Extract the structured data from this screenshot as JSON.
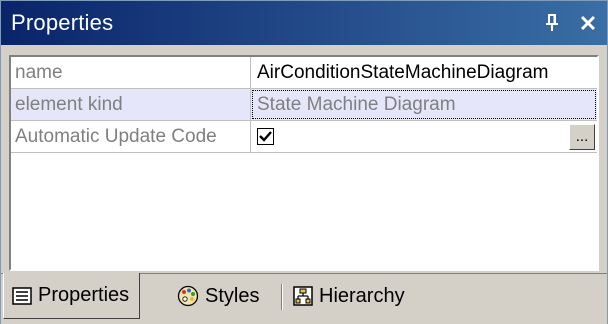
{
  "panel": {
    "title": "Properties",
    "controls": {
      "pin_icon": "pin-icon",
      "close_icon": "close-icon"
    }
  },
  "properties": [
    {
      "name": "name",
      "value": "AirConditionStateMachineDiagram",
      "selected": false
    },
    {
      "name": "element kind",
      "value": "State Machine Diagram",
      "selected": true
    },
    {
      "name": "Automatic Update Code",
      "value": "checked",
      "type": "checkbox",
      "has_ellipsis": true,
      "ellipsis_label": "..."
    }
  ],
  "tabs": [
    {
      "label": "Properties",
      "icon": "properties-list-icon",
      "active": true
    },
    {
      "label": "Styles",
      "icon": "palette-icon",
      "active": false
    },
    {
      "label": "Hierarchy",
      "icon": "hierarchy-icon",
      "active": false
    }
  ],
  "colors": {
    "title_gradient_start": "#0a246a",
    "title_gradient_end": "#3a6ea5",
    "selected_row": "#e6e6fa",
    "panel_bg": "#d4d0c8"
  }
}
